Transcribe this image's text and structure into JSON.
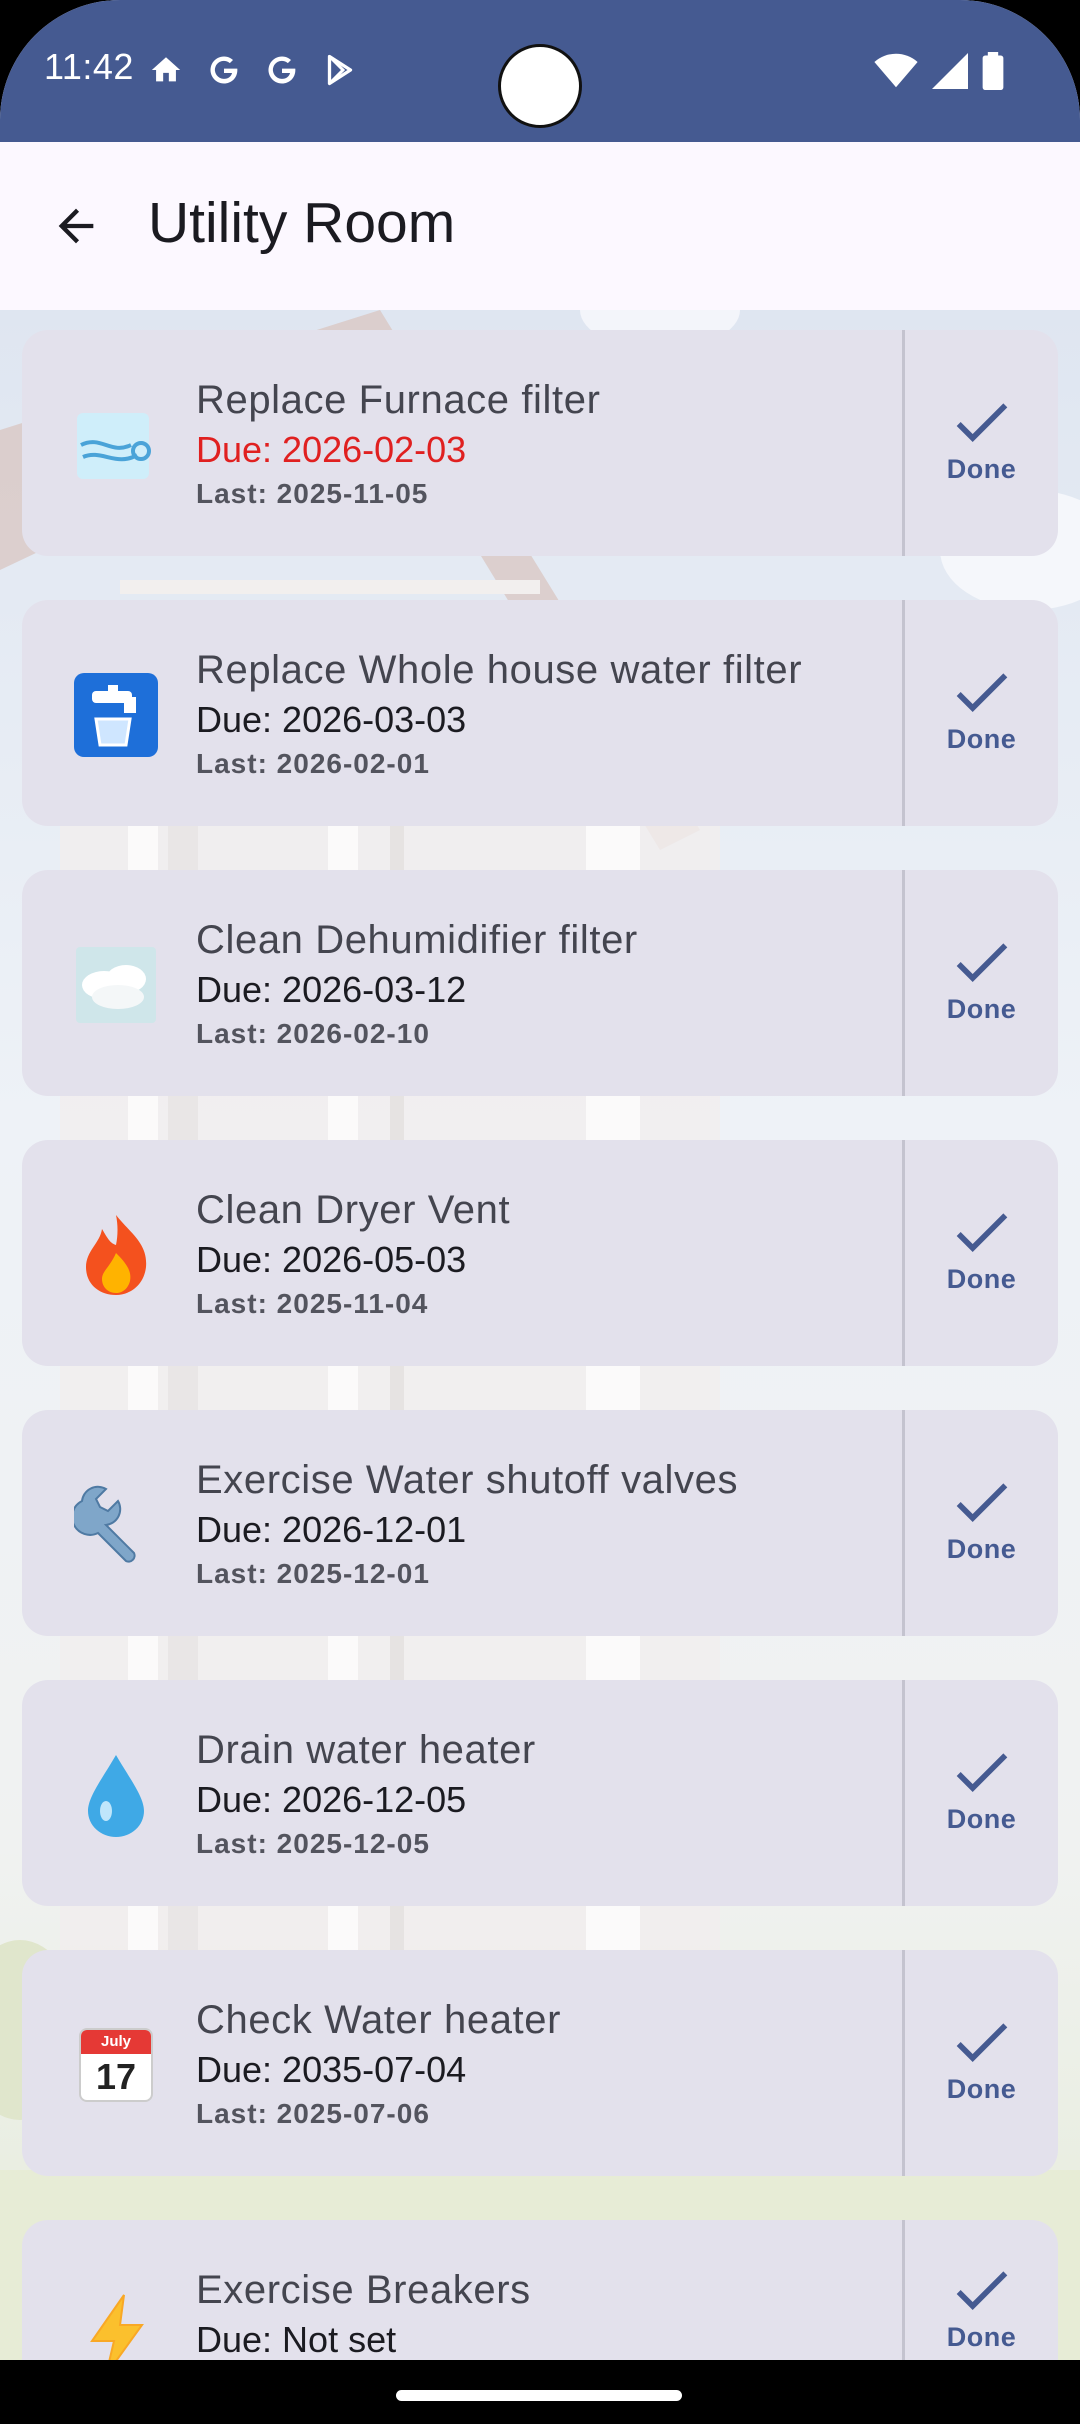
{
  "status_bar": {
    "time": "11:42",
    "left_icons": [
      "home-icon",
      "google-icon",
      "google-icon",
      "play-store-icon"
    ],
    "right_icons": [
      "wifi-icon",
      "signal-icon",
      "battery-icon"
    ]
  },
  "app_bar": {
    "title": "Utility Room",
    "back_icon": "arrow-back-icon"
  },
  "colors": {
    "status_bar": "#455a91",
    "accent": "#455a91",
    "card": "#e3e1ec",
    "overdue": "#e02020"
  },
  "tasks": [
    {
      "icon": "wind-icon",
      "title": "Replace Furnace filter",
      "due": "Due: 2026-02-03",
      "overdue": true,
      "last": "Last: 2025-11-05",
      "action": "Done"
    },
    {
      "icon": "faucet-icon",
      "title": "Replace Whole house water filter",
      "due": "Due: 2026-03-03",
      "overdue": false,
      "last": "Last: 2026-02-01",
      "action": "Done"
    },
    {
      "icon": "cloud-icon",
      "title": "Clean Dehumidifier filter",
      "due": "Due: 2026-03-12",
      "overdue": false,
      "last": "Last: 2026-02-10",
      "action": "Done"
    },
    {
      "icon": "fire-icon",
      "title": "Clean Dryer Vent",
      "due": "Due: 2026-05-03",
      "overdue": false,
      "last": "Last: 2025-11-04",
      "action": "Done"
    },
    {
      "icon": "wrench-icon",
      "title": "Exercise Water shutoff valves",
      "due": "Due: 2026-12-01",
      "overdue": false,
      "last": "Last: 2025-12-01",
      "action": "Done"
    },
    {
      "icon": "droplet-icon",
      "title": "Drain water heater",
      "due": "Due: 2026-12-05",
      "overdue": false,
      "last": "Last: 2025-12-05",
      "action": "Done"
    },
    {
      "icon": "calendar-icon",
      "calendar_month": "July",
      "calendar_day": "17",
      "title": "Check Water heater",
      "due": "Due: 2035-07-04",
      "overdue": false,
      "last": "Last: 2025-07-06",
      "action": "Done"
    },
    {
      "icon": "lightning-icon",
      "title": "Exercise Breakers",
      "due": "Due: Not set",
      "overdue": false,
      "last": "",
      "action": "Done"
    }
  ]
}
